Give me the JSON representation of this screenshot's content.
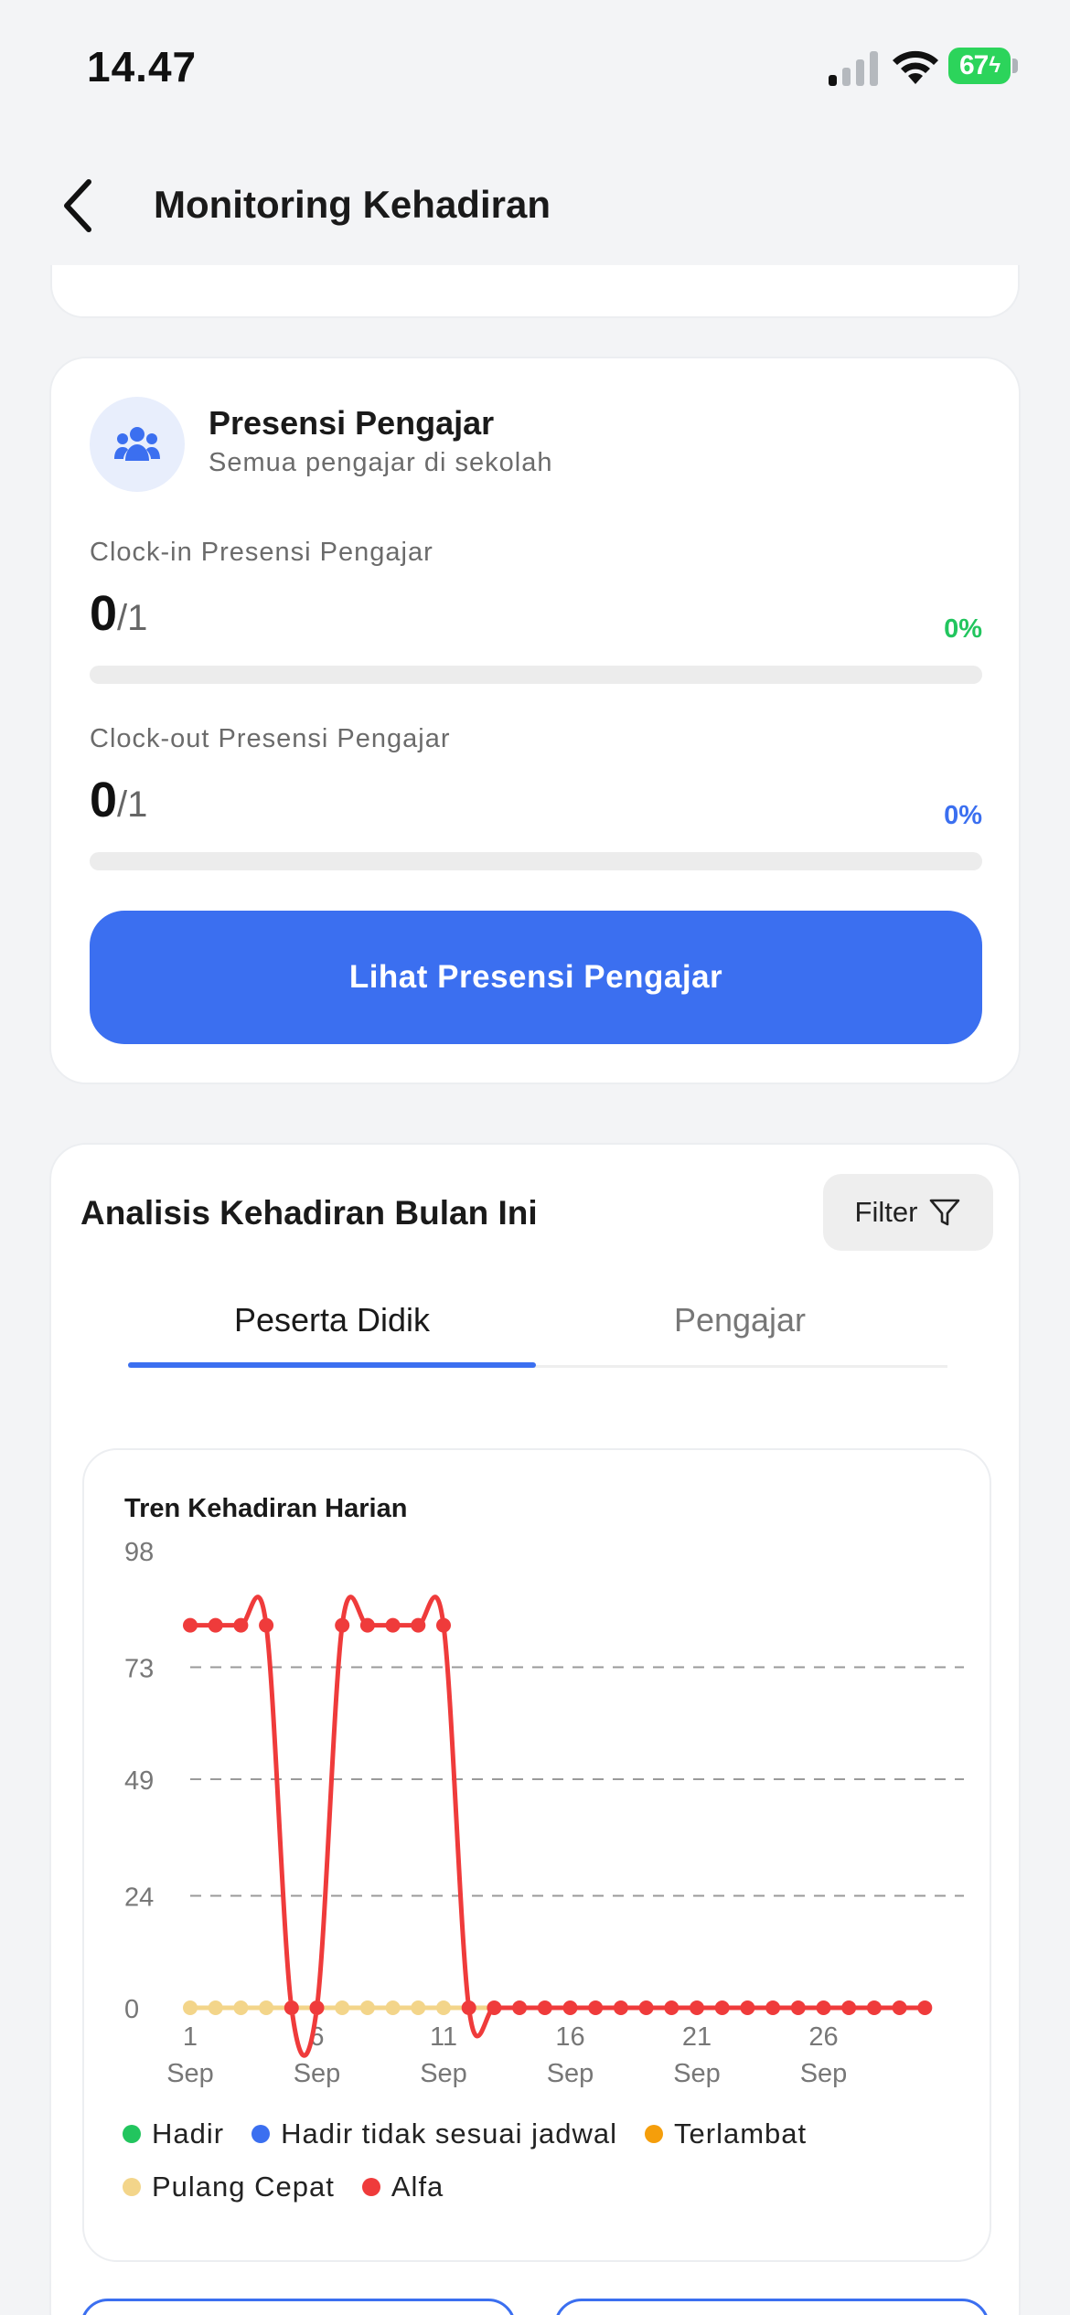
{
  "status_bar": {
    "time": "14.47",
    "battery": "67"
  },
  "header": {
    "title": "Monitoring Kehadiran"
  },
  "teacher_card": {
    "title": "Presensi Pengajar",
    "subtitle": "Semua pengajar di sekolah",
    "clock_in": {
      "label": "Clock-in Presensi Pengajar",
      "count": "0",
      "total": "/1",
      "percent": "0%",
      "progress": 0,
      "color": "#22c55e"
    },
    "clock_out": {
      "label": "Clock-out Presensi Pengajar",
      "count": "0",
      "total": "/1",
      "percent": "0%",
      "progress": 0,
      "color": "#3b6ff0"
    },
    "button_label": "Lihat Presensi Pengajar"
  },
  "analysis": {
    "title": "Analisis Kehadiran Bulan Ini",
    "filter_label": "Filter",
    "tabs": [
      {
        "label": "Peserta Didik",
        "active": true
      },
      {
        "label": "Pengajar",
        "active": false
      }
    ],
    "chart_title": "Tren Kehadiran Harian",
    "legend": [
      {
        "label": "Hadir",
        "color": "#22c55e"
      },
      {
        "label": "Hadir tidak sesuai jadwal",
        "color": "#3b6ff0"
      },
      {
        "label": "Terlambat",
        "color": "#f59e0b"
      },
      {
        "label": "Pulang Cepat",
        "color": "#f3d58a"
      },
      {
        "label": "Alfa",
        "color": "#ef3b3b"
      }
    ]
  },
  "chart_data": {
    "type": "line",
    "title": "Tren Kehadiran Harian",
    "xlabel": "",
    "ylabel": "",
    "x": [
      1,
      2,
      3,
      4,
      5,
      6,
      7,
      8,
      9,
      10,
      11,
      12,
      13,
      14,
      15,
      16,
      17,
      18,
      19,
      20,
      21,
      22,
      23,
      24,
      25,
      26,
      27,
      28,
      29,
      30
    ],
    "x_tick_values": [
      1,
      6,
      11,
      16,
      21,
      26
    ],
    "x_tick_labels": [
      [
        "1",
        "Sep"
      ],
      [
        "6",
        "Sep"
      ],
      [
        "11",
        "Sep"
      ],
      [
        "16",
        "Sep"
      ],
      [
        "21",
        "Sep"
      ],
      [
        "26",
        "Sep"
      ]
    ],
    "y_ticks": [
      0,
      24,
      49,
      73,
      98
    ],
    "ylim": [
      0,
      98
    ],
    "grid": "horizontal dashed",
    "legend_position": "bottom",
    "series": [
      {
        "name": "Hadir",
        "color": "#22c55e",
        "values": [
          0,
          0,
          0,
          0,
          0,
          0,
          0,
          0,
          0,
          0,
          0,
          0,
          0,
          0,
          0,
          0,
          0,
          0,
          0,
          0,
          0,
          0,
          0,
          0,
          0,
          0,
          0,
          0,
          0,
          0
        ],
        "markers": false
      },
      {
        "name": "Hadir tidak sesuai jadwal",
        "color": "#3b6ff0",
        "values": [
          0,
          0,
          0,
          0,
          0,
          0,
          0,
          0,
          0,
          0,
          0,
          0,
          0,
          0,
          0,
          0,
          0,
          0,
          0,
          0,
          0,
          0,
          0,
          0,
          0,
          0,
          0,
          0,
          0,
          0
        ],
        "markers": false
      },
      {
        "name": "Terlambat",
        "color": "#f59e0b",
        "values": [
          0,
          0,
          0,
          0,
          0,
          0,
          0,
          0,
          0,
          0,
          0,
          0,
          0,
          0,
          0,
          0,
          0,
          0,
          0,
          0,
          0,
          0,
          0,
          0,
          0,
          0,
          0,
          0,
          0,
          0
        ],
        "markers": false
      },
      {
        "name": "Pulang Cepat",
        "color": "#f3d58a",
        "values": [
          0,
          0,
          0,
          0,
          0,
          0,
          0,
          0,
          0,
          0,
          0,
          0,
          0,
          0,
          0,
          0,
          0,
          0,
          0,
          0,
          0,
          0,
          0,
          0,
          0,
          0,
          0,
          0,
          0,
          0
        ],
        "markers": true,
        "marker_days": [
          1,
          2,
          3,
          4,
          5,
          6,
          7,
          8,
          9,
          10,
          11
        ]
      },
      {
        "name": "Alfa",
        "color": "#ef3b3b",
        "values": [
          82,
          82,
          82,
          82,
          0,
          0,
          82,
          82,
          82,
          82,
          82,
          0,
          0,
          0,
          0,
          0,
          0,
          0,
          0,
          0,
          0,
          0,
          0,
          0,
          0,
          0,
          0,
          0,
          0,
          0
        ],
        "markers": true
      }
    ]
  }
}
